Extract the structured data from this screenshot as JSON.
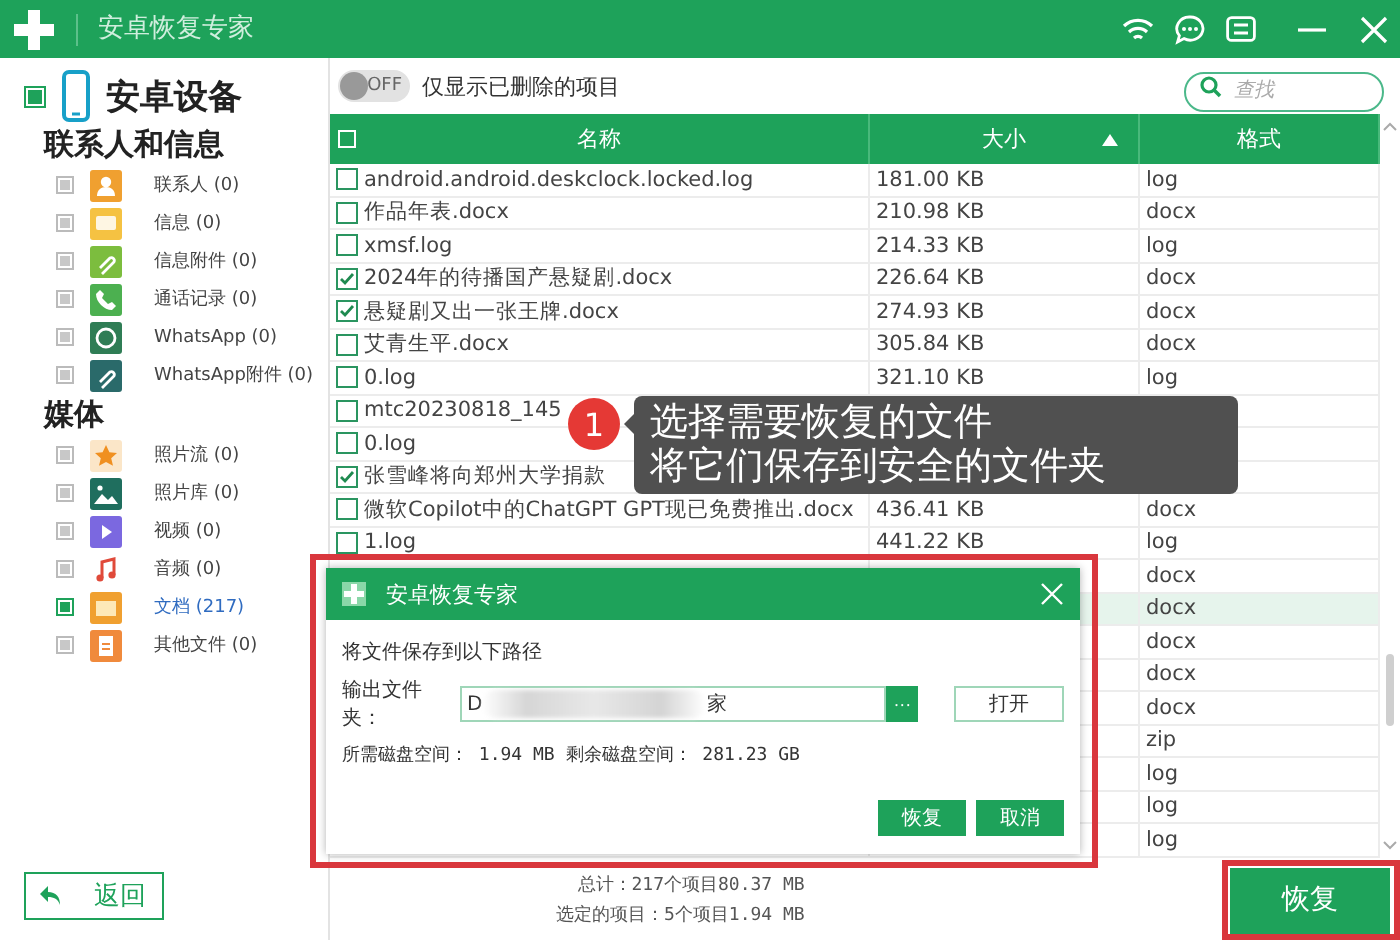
{
  "window": {
    "title": "安卓恢复专家"
  },
  "sidebar": {
    "device": {
      "label": "安卓设备",
      "checked": true
    },
    "groups": [
      {
        "title": "联系人和信息",
        "items": [
          {
            "label": "联系人 (0)",
            "checked": false
          },
          {
            "label": "信息 (0)",
            "checked": false
          },
          {
            "label": "信息附件 (0)",
            "checked": false
          },
          {
            "label": "通话记录 (0)",
            "checked": false
          },
          {
            "label": "WhatsApp (0)",
            "checked": false
          },
          {
            "label": "WhatsApp附件 (0)",
            "checked": false
          }
        ]
      },
      {
        "title": "媒体",
        "items": [
          {
            "label": "照片流 (0)",
            "checked": false
          },
          {
            "label": "照片库 (0)",
            "checked": false
          },
          {
            "label": "视频 (0)",
            "checked": false
          },
          {
            "label": "音频 (0)",
            "checked": false
          },
          {
            "label": "文档 (217)",
            "checked": true
          },
          {
            "label": "其他文件 (0)",
            "checked": false
          }
        ]
      }
    ],
    "back_button": "返回"
  },
  "filter": {
    "toggle": {
      "on": false,
      "label": "OFF"
    },
    "label": "仅显示已删除的项目"
  },
  "search": {
    "placeholder": "查找"
  },
  "table": {
    "select_all": {
      "checked": false
    },
    "columns": [
      {
        "label": "名称",
        "sorted": false
      },
      {
        "label": "大小",
        "sorted": true
      },
      {
        "label": "格式",
        "sorted": false
      }
    ],
    "rows": [
      {
        "name": "android.android.deskclock.locked.log",
        "size": "181.00 KB",
        "format": "log",
        "checked": false,
        "selected": false
      },
      {
        "name": "作品年表.docx",
        "size": "210.98 KB",
        "format": "docx",
        "checked": false,
        "selected": false
      },
      {
        "name": "xmsf.log",
        "size": "214.33 KB",
        "format": "log",
        "checked": false,
        "selected": false
      },
      {
        "name": "2024年的待播国产悬疑剧.docx",
        "size": "226.64 KB",
        "format": "docx",
        "checked": true,
        "selected": false
      },
      {
        "name": "悬疑剧又出一张王牌.docx",
        "size": "274.93 KB",
        "format": "docx",
        "checked": true,
        "selected": false
      },
      {
        "name": "艾青生平.docx",
        "size": "305.84 KB",
        "format": "docx",
        "checked": false,
        "selected": false
      },
      {
        "name": "0.log",
        "size": "321.10 KB",
        "format": "log",
        "checked": false,
        "selected": false
      },
      {
        "name": "mtc20230818_145",
        "checked": false,
        "selected": false
      },
      {
        "name": "0.log",
        "checked": false,
        "selected": false
      },
      {
        "name": "张雪峰将向郑州大学捐款",
        "checked": true,
        "selected": false
      },
      {
        "name": "微软Copilot中的ChatGPT GPT现已免费推出.docx",
        "size": "436.41 KB",
        "format": "docx",
        "checked": false,
        "selected": false
      },
      {
        "name": "1.log",
        "size": "441.22 KB",
        "format": "log",
        "checked": false,
        "selected": false
      },
      {
        "format": "docx",
        "selected": false
      },
      {
        "format": "docx",
        "selected": true
      },
      {
        "format": "docx",
        "selected": false
      },
      {
        "format": "docx",
        "selected": false
      },
      {
        "format": "docx",
        "selected": false
      },
      {
        "format": "zip",
        "selected": false
      },
      {
        "format": "log",
        "selected": false
      },
      {
        "format": "log",
        "selected": false
      },
      {
        "format": "log",
        "selected": false
      }
    ]
  },
  "totals": [
    "总计：217个项目80.37 MB",
    "选定的项目：5个项目1.94 MB"
  ],
  "recover_button": "恢复",
  "tip": {
    "step": "1",
    "lines": [
      "选择需要恢复的文件",
      "将它们保存到安全的文件夹"
    ]
  },
  "dialog": {
    "title": "安卓恢复专家",
    "prompt": "将文件保存到以下路径",
    "folder_label": "输出文件夹：",
    "folder_value_start": "D",
    "folder_value_end": "家",
    "browse_button": "···",
    "open_button": "打开",
    "space_info": "所需磁盘空间： 1.94 MB 剩余磁盘空间： 281.23 GB",
    "buttons": [
      "恢复",
      "取消"
    ]
  }
}
